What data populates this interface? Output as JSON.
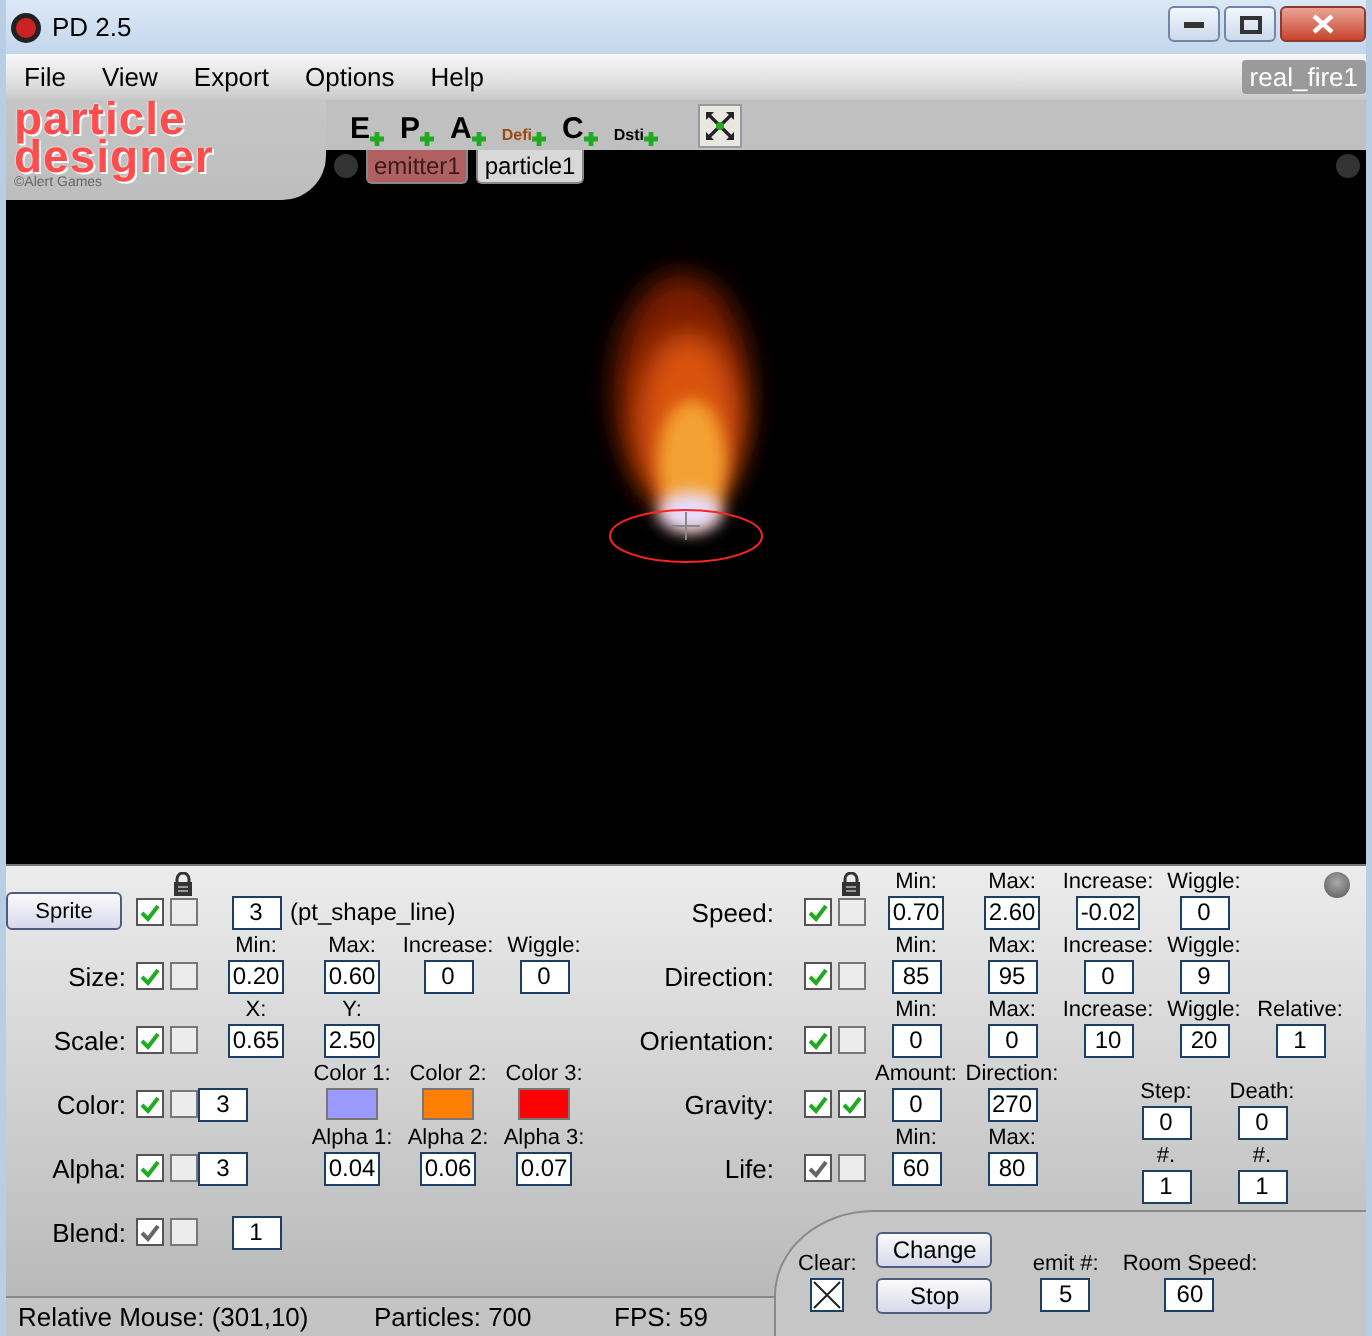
{
  "window": {
    "title": "PD 2.5"
  },
  "menu": [
    "File",
    "View",
    "Export",
    "Options",
    "Help"
  ],
  "document_name": "real_fire1",
  "logo": {
    "line1": "particle",
    "line2": "designer",
    "credit": "©Alert Games"
  },
  "tools": [
    {
      "label": "E",
      "color": "#000000"
    },
    {
      "label": "P",
      "color": "#000000"
    },
    {
      "label": "A",
      "color": "#000000"
    },
    {
      "label": "Defi",
      "color": "#9a4a10"
    },
    {
      "label": "C",
      "color": "#000000"
    },
    {
      "label": "Dsti",
      "color": "#000000"
    }
  ],
  "tabs": [
    {
      "label": "emitter1",
      "selected": true
    },
    {
      "label": "particle1",
      "selected": false
    }
  ],
  "left_params": [
    {
      "kind": "button",
      "label": "Sprite",
      "locked": true,
      "checks": [
        {
          "checked": true,
          "color": "#1faa1f"
        },
        {
          "checked": false
        }
      ],
      "fields": [
        {
          "value": "3"
        }
      ],
      "note": "(pt_shape_line)"
    },
    {
      "kind": "values",
      "label": "Size:",
      "locked": false,
      "checks": [
        {
          "checked": true,
          "color": "#1faa1f"
        },
        {
          "checked": false
        }
      ],
      "fields": [
        {
          "caption": "Min:",
          "value": "0.20"
        },
        {
          "caption": "Max:",
          "value": "0.60"
        },
        {
          "caption": "Increase:",
          "value": "0"
        },
        {
          "caption": "Wiggle:",
          "value": "0"
        }
      ]
    },
    {
      "kind": "values",
      "label": "Scale:",
      "locked": false,
      "checks": [
        {
          "checked": true,
          "color": "#1faa1f"
        },
        {
          "checked": false
        }
      ],
      "fields": [
        {
          "caption": "X:",
          "value": "0.65"
        },
        {
          "caption": "Y:",
          "value": "2.50"
        }
      ]
    },
    {
      "kind": "colors",
      "label": "Color:",
      "locked": false,
      "count": "3",
      "checks": [
        {
          "checked": true,
          "color": "#1faa1f"
        },
        {
          "checked": false
        }
      ],
      "fields": [
        {
          "caption": "Color 1:",
          "color": "#9999ff"
        },
        {
          "caption": "Color 2:",
          "color": "#ff8000"
        },
        {
          "caption": "Color 3:",
          "color": "#ff0000"
        }
      ]
    },
    {
      "kind": "values",
      "label": "Alpha:",
      "locked": false,
      "count": "3",
      "checks": [
        {
          "checked": true,
          "color": "#1faa1f"
        },
        {
          "checked": false
        }
      ],
      "fields": [
        {
          "caption": "Alpha 1:",
          "value": "0.04"
        },
        {
          "caption": "Alpha 2:",
          "value": "0.06"
        },
        {
          "caption": "Alpha 3:",
          "value": "0.07"
        }
      ]
    },
    {
      "kind": "values",
      "label": "Blend:",
      "locked": false,
      "checks": [
        {
          "checked": true,
          "color": "#666666"
        },
        {
          "checked": false
        }
      ],
      "fields": [
        {
          "value": "1"
        }
      ]
    }
  ],
  "right_params": [
    {
      "label": "Speed:",
      "locked": true,
      "checks": [
        {
          "checked": true,
          "color": "#1faa1f"
        },
        {
          "checked": false
        }
      ],
      "fields": [
        {
          "caption": "Min:",
          "value": "0.70"
        },
        {
          "caption": "Max:",
          "value": "2.60"
        },
        {
          "caption": "Increase:",
          "value": "-0.02"
        },
        {
          "caption": "Wiggle:",
          "value": "0"
        }
      ]
    },
    {
      "label": "Direction:",
      "locked": false,
      "checks": [
        {
          "checked": true,
          "color": "#1faa1f"
        },
        {
          "checked": false
        }
      ],
      "fields": [
        {
          "caption": "Min:",
          "value": "85"
        },
        {
          "caption": "Max:",
          "value": "95"
        },
        {
          "caption": "Increase:",
          "value": "0"
        },
        {
          "caption": "Wiggle:",
          "value": "9"
        }
      ]
    },
    {
      "label": "Orientation:",
      "locked": false,
      "checks": [
        {
          "checked": true,
          "color": "#1faa1f"
        },
        {
          "checked": false
        }
      ],
      "fields": [
        {
          "caption": "Min:",
          "value": "0"
        },
        {
          "caption": "Max:",
          "value": "0"
        },
        {
          "caption": "Increase:",
          "value": "10"
        },
        {
          "caption": "Wiggle:",
          "value": "20"
        },
        {
          "caption": "Relative:",
          "value": "1"
        }
      ]
    },
    {
      "label": "Gravity:",
      "locked": false,
      "checks": [
        {
          "checked": true,
          "color": "#1faa1f"
        },
        {
          "checked": true,
          "color": "#1faa1f"
        }
      ],
      "fields": [
        {
          "caption": "Amount:",
          "value": "0"
        },
        {
          "caption": "Direction:",
          "value": "270"
        }
      ],
      "side_fields": [
        {
          "caption": "Step:",
          "value": "0"
        },
        {
          "caption": "Death:",
          "value": "0"
        }
      ]
    },
    {
      "label": "Life:",
      "locked": false,
      "checks": [
        {
          "checked": true,
          "color": "#666666"
        },
        {
          "checked": false
        }
      ],
      "fields": [
        {
          "caption": "Min:",
          "value": "60"
        },
        {
          "caption": "Max:",
          "value": "80"
        }
      ],
      "side_fields": [
        {
          "caption": "#.",
          "value": "1"
        },
        {
          "caption": "#.",
          "value": "1"
        }
      ]
    }
  ],
  "actions": {
    "clear": {
      "label": "Clear:",
      "checked": true
    },
    "buttons": [
      "Change",
      "Stop"
    ],
    "fields": [
      {
        "caption": "emit #:",
        "value": "5"
      },
      {
        "caption": "Room Speed:",
        "value": "60"
      }
    ]
  },
  "status_bar": [
    "Relative Mouse: (301,10)",
    "Particles: 700",
    "FPS: 59"
  ]
}
